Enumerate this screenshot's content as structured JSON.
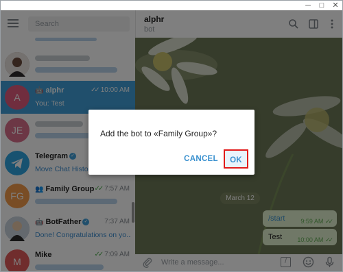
{
  "window": {
    "minimize_glyph": "─",
    "maximize_glyph": "□",
    "close_glyph": "✕"
  },
  "sidebar": {
    "search_placeholder": "Search",
    "chats": [
      {
        "name": "",
        "time": "",
        "preview": "",
        "avatar_letters": "",
        "avatar_color": "#9b7a6a",
        "blurred": true
      },
      {
        "name": "alphr",
        "time": "10:00 AM",
        "preview": "You: Test",
        "avatar_letters": "A",
        "avatar_color": "#e15a7c",
        "active": true,
        "is_bot": true,
        "read": true
      },
      {
        "name": "",
        "time": "",
        "preview": "",
        "avatar_letters": "JE",
        "avatar_color": "#d96e8b",
        "blurred": true
      },
      {
        "name": "Telegram",
        "time": "",
        "preview": "Move Chat History",
        "avatar_letters": "",
        "avatar_color": "#2ea5e0",
        "verified": true
      },
      {
        "name": "Family Group",
        "time": "7:57 AM",
        "preview": "",
        "avatar_letters": "FG",
        "avatar_color": "#f39a4b",
        "group": true,
        "read": true
      },
      {
        "name": "BotFather",
        "time": "7:37 AM",
        "preview": "Done! Congratulations on yo...",
        "avatar_letters": "",
        "avatar_color": "#6a8fb5",
        "is_bot": true,
        "verified": true
      },
      {
        "name": "Mike",
        "time": "7:09 AM",
        "preview": "",
        "avatar_letters": "M",
        "avatar_color": "#e15a5a",
        "read": true
      }
    ]
  },
  "main": {
    "title": "alphr",
    "subtitle": "bot",
    "date_separator": "March 12",
    "messages": [
      {
        "text": "/start",
        "time": "9:59 AM"
      },
      {
        "text": "Test",
        "time": "10:00 AM"
      }
    ],
    "composer_placeholder": "Write a message..."
  },
  "dialog": {
    "message": "Add the bot to «Family Group»?",
    "cancel_label": "CANCEL",
    "ok_label": "OK"
  },
  "colors": {
    "accent": "#419fd9",
    "highlight_border": "#e11b1b",
    "bubble": "#e1f1cf"
  }
}
